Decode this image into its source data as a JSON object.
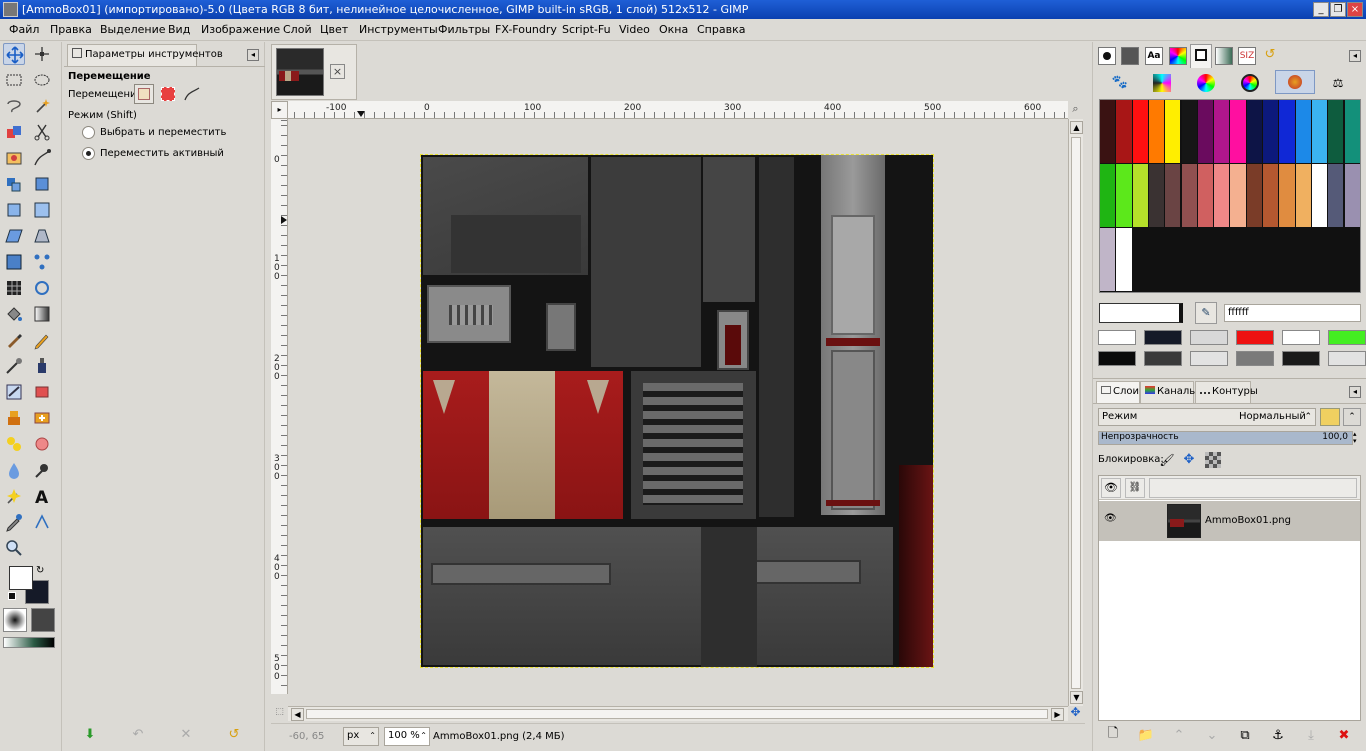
{
  "window": {
    "title": "[AmmoBox01] (импортировано)-5.0 (Цвета RGB 8 бит, нелинейное целочисленное, GIMP built-in sRGB, 1 слой) 512x512 - GIMP",
    "minimize": "_",
    "maximize": "❐",
    "close": "×"
  },
  "menu": [
    "Файл",
    "Правка",
    "Выделение",
    "Вид",
    "Изображение",
    "Слой",
    "Цвет",
    "Инструменты",
    "Фильтры",
    "FX-Foundry",
    "Script-Fu",
    "Video",
    "Окна",
    "Справка"
  ],
  "tool_options": {
    "tab_label": "Параметры инструментов",
    "heading": "Перемещение",
    "move_label": "Перемещение:",
    "mode_label": "Режим (Shift)",
    "option1": "Выбрать и переместить",
    "option2": "Переместить активный",
    "selected_option": 2
  },
  "rulers": {
    "h_labels": [
      "-100",
      "0",
      "100",
      "200",
      "300",
      "400",
      "500",
      "600"
    ],
    "v_labels": [
      "0",
      "100",
      "200",
      "300",
      "400",
      "500"
    ]
  },
  "statusbar": {
    "coords": "-60, 65",
    "unit": "px",
    "zoom": "100 %",
    "file_info": "AmmoBox01.png (2,4 МБ)"
  },
  "colors": {
    "hex_value": "ffffff",
    "palette_row1": [
      "#3a1212",
      "#a81616",
      "#ff1010",
      "#ff7a00",
      "#ffee00",
      "#161616",
      "#6a0b5e",
      "#b0168c",
      "#ff0fa0",
      "#0d1446",
      "#0c197c",
      "#1028d6",
      "#1c89e8",
      "#3bb3f0",
      "#0e5c3e",
      "#13907a"
    ],
    "palette_row2": [
      "#1fb513",
      "#5ce81b",
      "#b5e02a",
      "#3a3232",
      "#6a4444",
      "#905050",
      "#d06060",
      "#f08888",
      "#f4b090",
      "#7a3c28",
      "#b55830",
      "#e08c40",
      "#f0b060",
      "#ffffff",
      "#555a78",
      "#9a90b0"
    ],
    "palette_row3": [
      "#c0b5c8",
      "#ffffff"
    ],
    "history_row1": [
      "#ffffff",
      "#151a28",
      "#d8d8d8",
      "#ee1111",
      "#ffffff",
      "#44ee22"
    ],
    "history_row2": [
      "#0a0a0a",
      "#3a3a3a",
      "#e2e2e2",
      "#7a7a7a",
      "#1a1a1a",
      "#e2e2e2"
    ],
    "fg": "#ffffff",
    "bg": "#151a28"
  },
  "layers": {
    "tab_layers": "Слои",
    "tab_channels": "Каналы",
    "tab_paths": "Контуры",
    "mode_label": "Режим",
    "mode_value": "Нормальный",
    "opacity_label": "Непрозрачность",
    "opacity_value": "100,0",
    "opacity_level": 1.0,
    "lock_label": "Блокировка:",
    "layer_name": "AmmoBox01.png"
  }
}
